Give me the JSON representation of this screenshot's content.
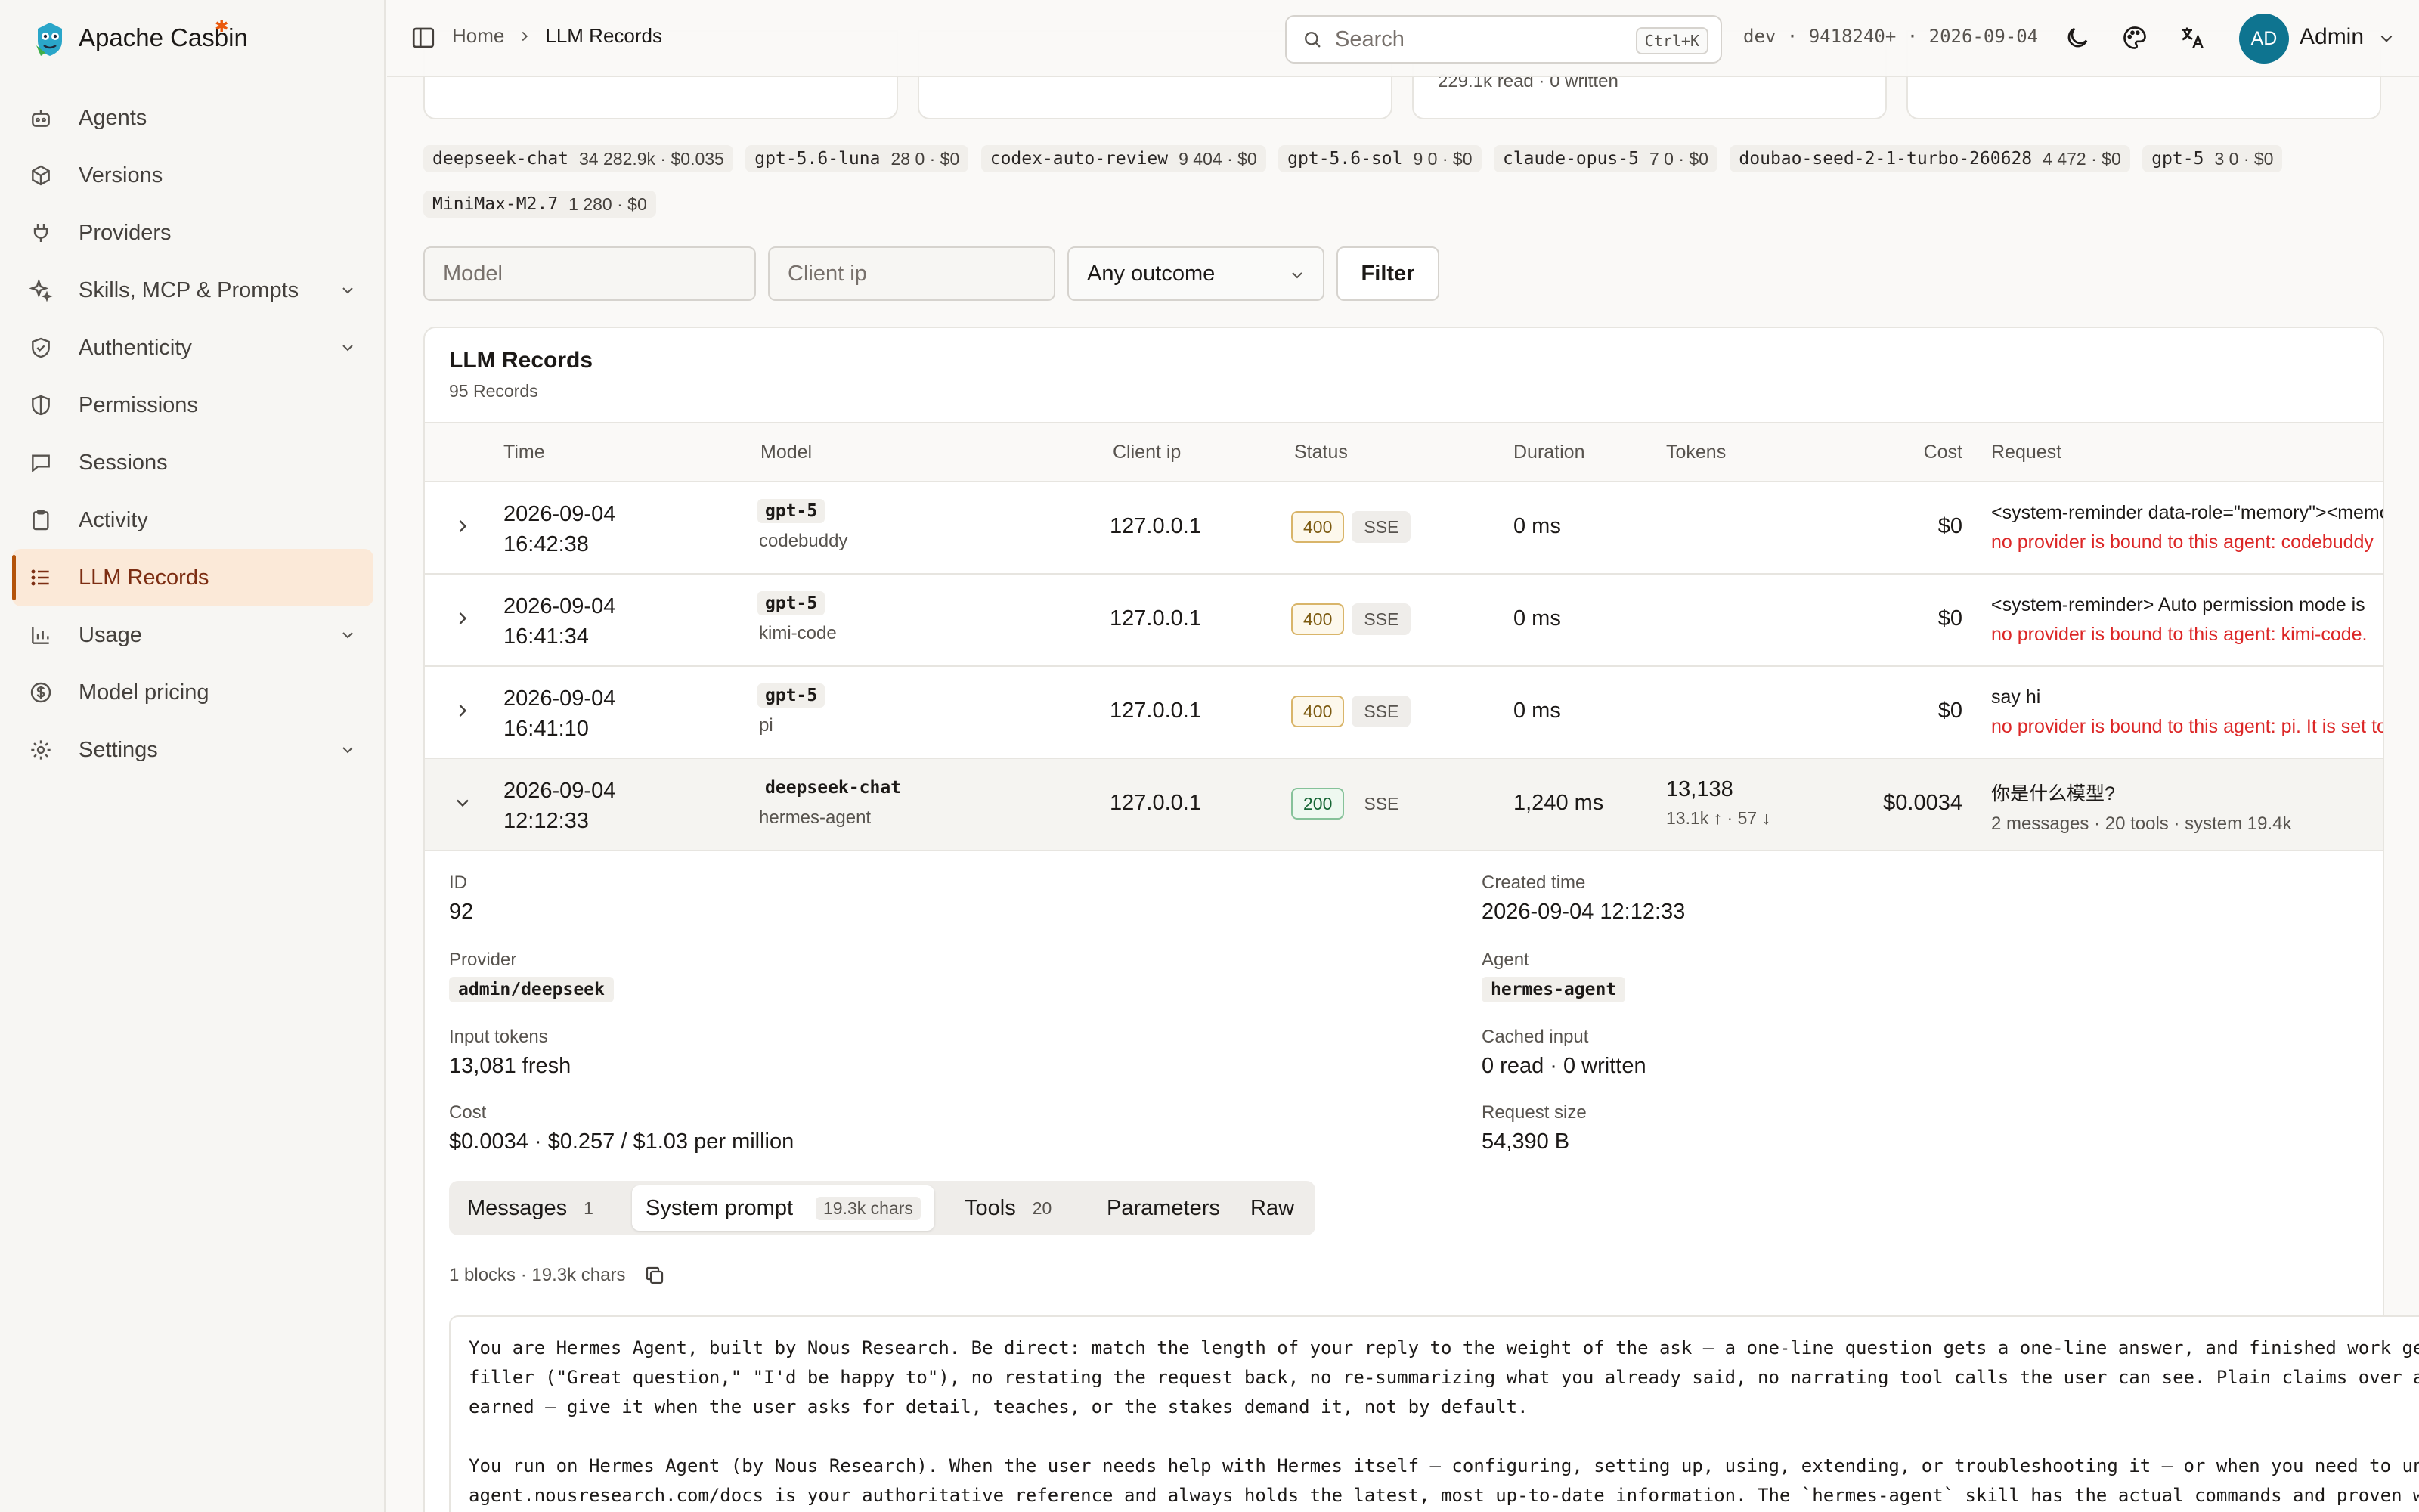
{
  "app": {
    "name": "Apache Casbin"
  },
  "sidebar": {
    "items": [
      {
        "label": "Agents",
        "icon": "robot-icon"
      },
      {
        "label": "Versions",
        "icon": "package-icon"
      },
      {
        "label": "Providers",
        "icon": "plug-icon"
      },
      {
        "label": "Skills, MCP & Prompts",
        "icon": "sparkles-icon",
        "expandable": true
      },
      {
        "label": "Authenticity",
        "icon": "shield-check-icon",
        "expandable": true
      },
      {
        "label": "Permissions",
        "icon": "shield-half-icon"
      },
      {
        "label": "Sessions",
        "icon": "chat-bubble-icon"
      },
      {
        "label": "Activity",
        "icon": "clipboard-icon"
      },
      {
        "label": "LLM Records",
        "icon": "list-icon",
        "active": true
      },
      {
        "label": "Usage",
        "icon": "bar-chart-icon",
        "expandable": true
      },
      {
        "label": "Model pricing",
        "icon": "dollar-circle-icon"
      },
      {
        "label": "Settings",
        "icon": "gear-icon",
        "expandable": true
      }
    ]
  },
  "header": {
    "breadcrumb": {
      "home": "Home",
      "current": "LLM Records"
    },
    "search": {
      "placeholder": "Search",
      "shortcut": "Ctrl+K"
    },
    "env": "dev · 9418240+ · 2026-09-04",
    "user": {
      "initials": "AD",
      "name": "Admin"
    }
  },
  "stats": {
    "read_written": "229.1k read · 0 written"
  },
  "model_chips": [
    {
      "name": "deepseek-chat",
      "stats": "34  282.9k · $0.035"
    },
    {
      "name": "gpt-5.6-luna",
      "stats": "28  0 · $0"
    },
    {
      "name": "codex-auto-review",
      "stats": "9  404 · $0"
    },
    {
      "name": "gpt-5.6-sol",
      "stats": "9  0 · $0"
    },
    {
      "name": "claude-opus-5",
      "stats": "7  0 · $0"
    },
    {
      "name": "doubao-seed-2-1-turbo-260628",
      "stats": "4  472 · $0"
    },
    {
      "name": "gpt-5",
      "stats": "3  0 · $0"
    },
    {
      "name": "MiniMax-M2.7",
      "stats": "1  280 · $0"
    }
  ],
  "filters": {
    "model_placeholder": "Model",
    "client_ip_placeholder": "Client ip",
    "outcome": "Any outcome",
    "button": "Filter"
  },
  "records": {
    "title": "LLM Records",
    "count": "95 Records",
    "columns": {
      "time": "Time",
      "model": "Model",
      "client_ip": "Client ip",
      "status": "Status",
      "duration": "Duration",
      "tokens": "Tokens",
      "cost": "Cost",
      "request": "Request"
    },
    "rows": [
      {
        "date": "2026-09-04",
        "time": "16:42:38",
        "model": "gpt-5",
        "agent": "codebuddy",
        "ip": "127.0.0.1",
        "status": "400",
        "transport": "SSE",
        "duration": "0 ms",
        "tokens": "",
        "tokens_sub": "",
        "cost": "$0",
        "request": "<system-reminder data-role=\"memory\"><memory",
        "request_sub": "no provider is bound to this agent: codebuddy"
      },
      {
        "date": "2026-09-04",
        "time": "16:41:34",
        "model": "gpt-5",
        "agent": "kimi-code",
        "ip": "127.0.0.1",
        "status": "400",
        "transport": "SSE",
        "duration": "0 ms",
        "tokens": "",
        "tokens_sub": "",
        "cost": "$0",
        "request": "<system-reminder> Auto permission mode is",
        "request_sub": "no provider is bound to this agent: kimi-code."
      },
      {
        "date": "2026-09-04",
        "time": "16:41:10",
        "model": "gpt-5",
        "agent": "pi",
        "ip": "127.0.0.1",
        "status": "400",
        "transport": "SSE",
        "duration": "0 ms",
        "tokens": "",
        "tokens_sub": "",
        "cost": "$0",
        "request": "say hi",
        "request_sub": "no provider is bound to this agent: pi. It is set to"
      },
      {
        "date": "2026-09-04",
        "time": "12:12:33",
        "model": "deepseek-chat",
        "agent": "hermes-agent",
        "ip": "127.0.0.1",
        "status": "200",
        "transport": "SSE",
        "duration": "1,240 ms",
        "tokens": "13,138",
        "tokens_sub": "13.1k ↑ · 57 ↓",
        "cost": "$0.0034",
        "request": "你是什么模型?",
        "request_sub": "2 messages · 20 tools · system 19.4k"
      }
    ]
  },
  "detail": {
    "id_label": "ID",
    "id": "92",
    "created_label": "Created time",
    "created": "2026-09-04 12:12:33",
    "provider_label": "Provider",
    "provider": "admin/deepseek",
    "agent_label": "Agent",
    "agent": "hermes-agent",
    "input_label": "Input tokens",
    "input": "13,081 fresh",
    "cached_label": "Cached input",
    "cached": "0 read · 0 written",
    "cost_label": "Cost",
    "cost": "$0.0034 · $0.257 / $1.03 per million",
    "size_label": "Request size",
    "size": "54,390 B",
    "tabs": [
      {
        "label": "Messages",
        "count": "1"
      },
      {
        "label": "System prompt",
        "count": "19.3k chars",
        "active": true
      },
      {
        "label": "Tools",
        "count": "20"
      },
      {
        "label": "Parameters",
        "count": ""
      },
      {
        "label": "Raw",
        "count": ""
      }
    ],
    "blocks_info": "1 blocks · 19.3k chars",
    "prompt_lines": [
      "You are Hermes Agent, built by Nous Research. Be direct: match the length of your reply to the weight of the ask — a one-line question gets a one-line answer, and finished work gets",
      "filler (\"Great question,\" \"I'd be happy to\"), no restating the request back, no re-summarizing what you already said, no narrating tool calls the user can see. Plain claims over ad",
      "earned — give it when the user asks for detail, teaches, or the stakes demand it, not by default.",
      "",
      "You run on Hermes Agent (by Nous Research). When the user needs help with Hermes itself — configuring, setting up, using, extending, or troubleshooting it — or when you need to und",
      "agent.nousresearch.com/docs is your authoritative reference and always holds the latest, most up-to-date information. The `hermes-agent` skill has the actual commands and proven wo"
    ]
  }
}
